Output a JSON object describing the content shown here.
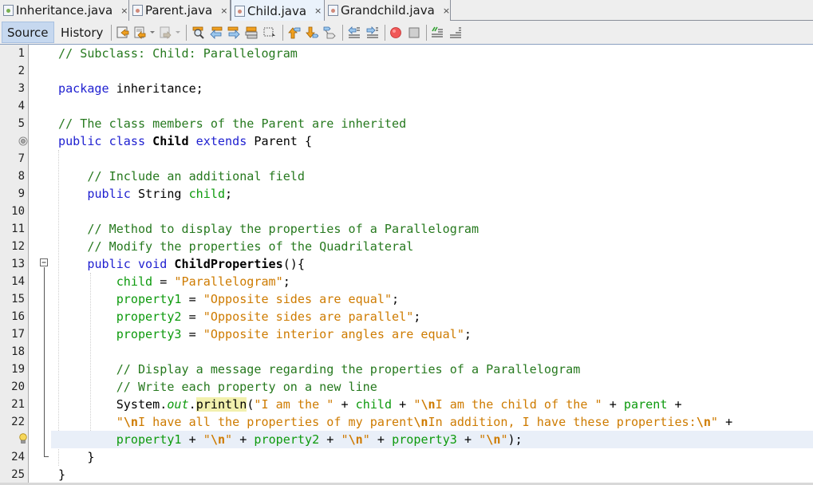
{
  "tabs": [
    {
      "label": "Inheritance.java",
      "icon": "java-main-file-icon",
      "active": false
    },
    {
      "label": "Parent.java",
      "icon": "java-file-icon",
      "active": false
    },
    {
      "label": "Child.java",
      "icon": "java-file-icon",
      "active": true
    },
    {
      "label": "Grandchild.java",
      "icon": "java-file-icon",
      "active": false
    }
  ],
  "tab_close_glyph": "×",
  "toolbar": {
    "source_label": "Source",
    "history_label": "History",
    "icons": [
      "last-edit-icon",
      "back-icon",
      "forward-icon",
      "find-icon",
      "find-previous-icon",
      "find-next-icon",
      "toggle-highlight-icon",
      "rectangular-selection-icon",
      "previous-bookmark-icon",
      "next-bookmark-icon",
      "toggle-bookmark-icon",
      "shift-left-icon",
      "shift-right-icon",
      "start-macro-icon",
      "stop-macro-icon",
      "comment-icon",
      "uncomment-icon"
    ]
  },
  "editor": {
    "current_line": 23,
    "line_numbers": [
      "1",
      "2",
      "3",
      "4",
      "5",
      "",
      "7",
      "8",
      "9",
      "10",
      "11",
      "12",
      "13",
      "14",
      "15",
      "16",
      "17",
      "18",
      "19",
      "20",
      "21",
      "22",
      "",
      "24",
      "25"
    ],
    "lines": {
      "l1": "// Subclass: Child: Parallelogram",
      "l3_kw": "package",
      "l3_rest": " inheritance;",
      "l5": "// The class members of the Parent are inherited",
      "l6_kw1": "public class ",
      "l6_name": "Child",
      "l6_kw2": " extends ",
      "l6_rest": "Parent {",
      "l8": "// Include an additional field",
      "l9_kw": "public",
      "l9_type": " String ",
      "l9_fld": "child",
      "l9_end": ";",
      "l11": "// Method to display the properties of a Parallelogram",
      "l12": "// Modify the properties of the Quadrilateral",
      "l13_kw": "public void ",
      "l13_name": "ChildProperties",
      "l13_end": "(){",
      "l14_fld": "child",
      "l14_eq": " = ",
      "l14_str": "\"Parallelogram\"",
      "l14_end": ";",
      "l15_fld": "property1",
      "l15_eq": " = ",
      "l15_str": "\"Opposite sides are equal\"",
      "l15_end": ";",
      "l16_fld": "property2",
      "l16_eq": " = ",
      "l16_str": "\"Opposite sides are parallel\"",
      "l16_end": ";",
      "l17_fld": "property3",
      "l17_eq": " = ",
      "l17_str": "\"Opposite interior angles are equal\"",
      "l17_end": ";",
      "l19": "// Display a message regarding the properties of a Parallelogram",
      "l20": "// Write each property on a new line",
      "l21_a": "System.",
      "l21_out": "out",
      "l21_dot": ".",
      "l21_println": "println",
      "l21_paren": "(",
      "l21_s1": "\"I am the \"",
      "l21_plus1": " + ",
      "l21_child": "child",
      "l21_plus2": " + ",
      "l21_s2a": "\"",
      "l21_esc": "\\n",
      "l21_s2b": "I am the child of the \"",
      "l21_plus3": " + ",
      "l21_parent": "parent",
      "l21_plus4": " +",
      "l22_s1": "\"",
      "l22_esc1": "\\n",
      "l22_s2": "I have all the properties of my parent",
      "l22_esc2": "\\n",
      "l22_s3": "In addition, I have these properties:",
      "l22_esc3": "\\n",
      "l22_s4": "\"",
      "l22_plus": " +",
      "l23_p1": "property1",
      "l23_plus1": " + ",
      "l23_q1": "\"",
      "l23_esc1": "\\n",
      "l23_q1b": "\"",
      "l23_plus2": " + ",
      "l23_p2": "property2",
      "l23_plus3": " + ",
      "l23_q2": "\"",
      "l23_esc2": "\\n",
      "l23_q2b": "\"",
      "l23_plus4": " + ",
      "l23_p3": "property3",
      "l23_plus5": " + ",
      "l23_q3": "\"",
      "l23_esc3": "\\n",
      "l23_q3b": "\"",
      "l23_end": ");",
      "l24": "}",
      "l25": "}"
    }
  }
}
